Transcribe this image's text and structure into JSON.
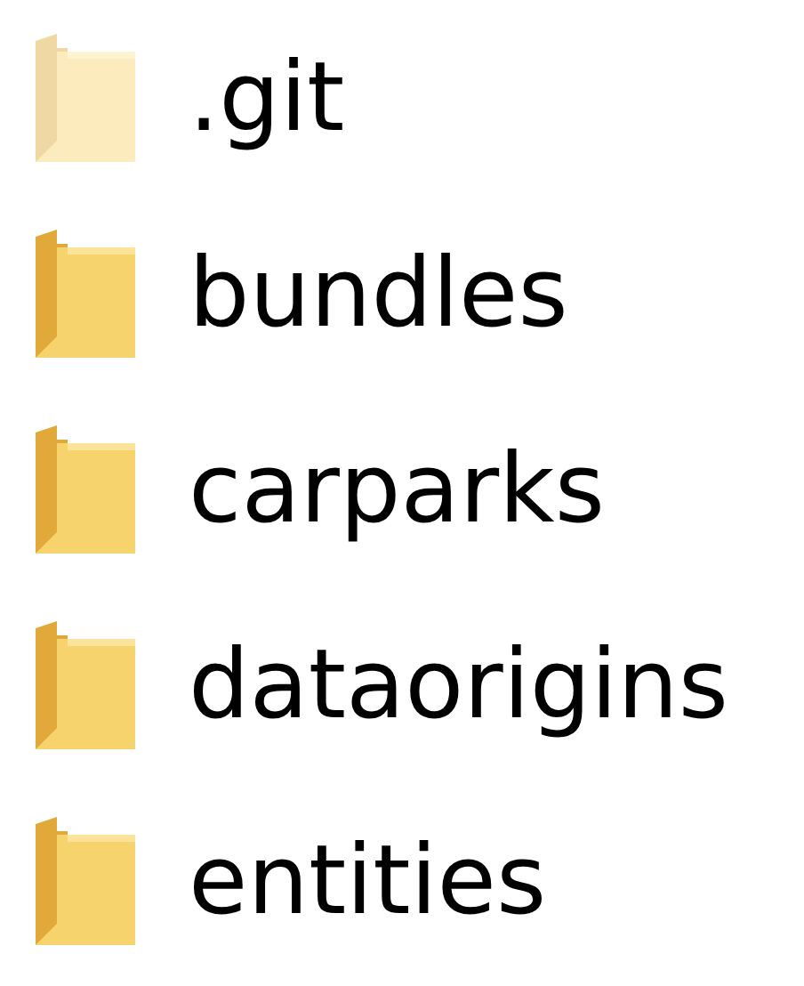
{
  "files": [
    {
      "name": ".git",
      "hidden": true
    },
    {
      "name": "bundles",
      "hidden": false
    },
    {
      "name": "carparks",
      "hidden": false
    },
    {
      "name": "dataorigins",
      "hidden": false
    },
    {
      "name": "entities",
      "hidden": false
    }
  ]
}
